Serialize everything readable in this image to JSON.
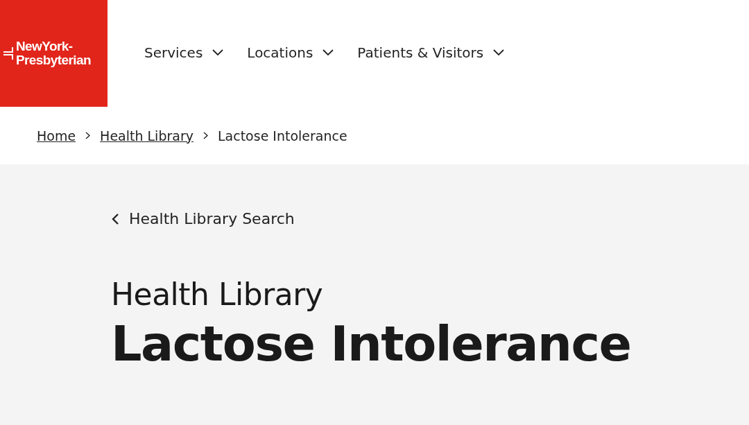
{
  "logo": {
    "lines": [
      "NewYork-",
      "Presbyterian"
    ]
  },
  "nav": [
    {
      "label": "Services",
      "expanded": false
    },
    {
      "label": "Locations",
      "expanded": false
    },
    {
      "label": "Patients & Visitors",
      "expanded": false
    }
  ],
  "breadcrumb": [
    {
      "label": "Home",
      "kind": "link"
    },
    {
      "label": "Health Library",
      "kind": "link"
    },
    {
      "label": "Lactose Intolerance",
      "kind": "current"
    }
  ],
  "back_link": "Health Library Search",
  "eyebrow": "Health Library",
  "title": "Lactose Intolerance"
}
